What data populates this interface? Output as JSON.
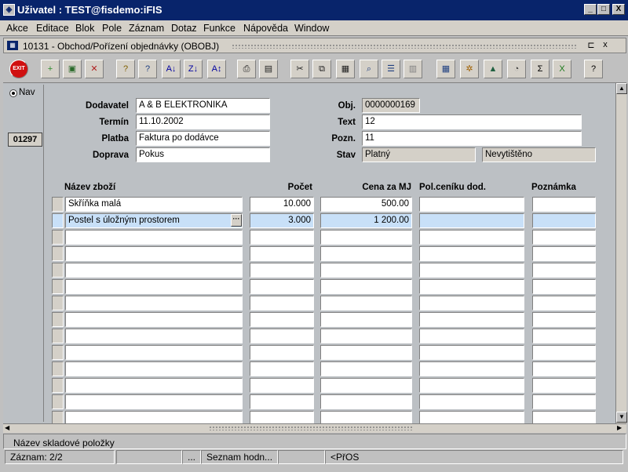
{
  "window": {
    "title": "Uživatel : TEST@fisdemo:iFIS",
    "minimize": "_",
    "maximize": "□",
    "close": "X"
  },
  "menu": [
    "Akce",
    "Editace",
    "Blok",
    "Pole",
    "Záznam",
    "Dotaz",
    "Funkce",
    "Nápověda",
    "Window"
  ],
  "subwindow": {
    "title": "10131 - Obchod/Pořízení objednávky (OBOBJ)"
  },
  "toolbar": [
    {
      "name": "exit-icon",
      "glyph": "EXIT",
      "color": "#d01010"
    },
    {
      "name": "insert-record-icon",
      "glyph": "+",
      "color": "#2a8a2a"
    },
    {
      "name": "save-icon",
      "glyph": "▣",
      "color": "#2a6a2a"
    },
    {
      "name": "delete-record-icon",
      "glyph": "✕",
      "color": "#b02020"
    },
    {
      "name": "query-icon",
      "glyph": "?",
      "color": "#806000"
    },
    {
      "name": "execute-query-icon",
      "glyph": "?",
      "color": "#204080"
    },
    {
      "name": "sort-asc-icon",
      "glyph": "A↓",
      "color": "#0000a0"
    },
    {
      "name": "sort-desc-icon",
      "glyph": "Z↓",
      "color": "#0000a0"
    },
    {
      "name": "sort-multi-icon",
      "glyph": "A↕",
      "color": "#0000a0"
    },
    {
      "name": "print-icon",
      "glyph": "⎙",
      "color": "#202020"
    },
    {
      "name": "print-preview-icon",
      "glyph": "▤",
      "color": "#202020"
    },
    {
      "name": "cut-icon",
      "glyph": "✂",
      "color": "#202020"
    },
    {
      "name": "copy-icon",
      "glyph": "⧉",
      "color": "#202020"
    },
    {
      "name": "paste-icon",
      "glyph": "▦",
      "color": "#202020"
    },
    {
      "name": "find-icon",
      "glyph": "⌕",
      "color": "#204080"
    },
    {
      "name": "list-icon",
      "glyph": "☰",
      "color": "#204080"
    },
    {
      "name": "columns-icon",
      "glyph": "▥",
      "color": "#808080"
    },
    {
      "name": "calculator-icon",
      "glyph": "▦",
      "color": "#204080"
    },
    {
      "name": "tools-icon",
      "glyph": "✲",
      "color": "#a06000"
    },
    {
      "name": "triangle-icon",
      "glyph": "▲",
      "color": "#206040"
    },
    {
      "name": "clock-icon",
      "glyph": "◔",
      "color": "#404040"
    },
    {
      "name": "sum-icon",
      "glyph": "Σ",
      "color": "#000000"
    },
    {
      "name": "excel-icon",
      "glyph": "X",
      "color": "#1a7a1a"
    },
    {
      "name": "help-icon",
      "glyph": "?",
      "color": "#000000"
    }
  ],
  "nav": {
    "label": "Nav",
    "record": "01297"
  },
  "header": {
    "dodavatel": {
      "label": "Dodavatel",
      "value": "A & B ELEKTRONIKA"
    },
    "termin": {
      "label": "Termín",
      "value": "11.10.2002"
    },
    "platba": {
      "label": "Platba",
      "value": "Faktura po dodávce"
    },
    "doprava": {
      "label": "Doprava",
      "value": "Pokus"
    },
    "obj": {
      "label": "Obj.",
      "value": "0000000169"
    },
    "text": {
      "label": "Text",
      "value": "12"
    },
    "pozn": {
      "label": "Pozn.",
      "value": "11"
    },
    "stav": {
      "label": "Stav",
      "value": "Platný",
      "value2": "Nevytištěno"
    }
  },
  "items": {
    "columns": [
      "Název zboží",
      "Počet",
      "Cena za MJ",
      "Pol.ceníku dod.",
      "Poznámka"
    ],
    "rows": [
      {
        "name": "Skříňka malá",
        "qty": "10.000",
        "price": "500.00",
        "pol": "",
        "note": ""
      },
      {
        "name": "Postel s úložným prostorem",
        "qty": "3.000",
        "price": "1 200.00",
        "pol": "",
        "note": ""
      },
      {
        "name": "",
        "qty": "",
        "price": "",
        "pol": "",
        "note": ""
      },
      {
        "name": "",
        "qty": "",
        "price": "",
        "pol": "",
        "note": ""
      },
      {
        "name": "",
        "qty": "",
        "price": "",
        "pol": "",
        "note": ""
      },
      {
        "name": "",
        "qty": "",
        "price": "",
        "pol": "",
        "note": ""
      },
      {
        "name": "",
        "qty": "",
        "price": "",
        "pol": "",
        "note": ""
      },
      {
        "name": "",
        "qty": "",
        "price": "",
        "pol": "",
        "note": ""
      },
      {
        "name": "",
        "qty": "",
        "price": "",
        "pol": "",
        "note": ""
      },
      {
        "name": "",
        "qty": "",
        "price": "",
        "pol": "",
        "note": ""
      },
      {
        "name": "",
        "qty": "",
        "price": "",
        "pol": "",
        "note": ""
      },
      {
        "name": "",
        "qty": "",
        "price": "",
        "pol": "",
        "note": ""
      },
      {
        "name": "",
        "qty": "",
        "price": "",
        "pol": "",
        "note": ""
      },
      {
        "name": "",
        "qty": "",
        "price": "",
        "pol": "",
        "note": ""
      }
    ]
  },
  "hint": "Název skladové položky",
  "statusbar": {
    "record": "Záznam: 2/2",
    "s2": "",
    "s3": "...",
    "s4": "Seznam hodn...",
    "s5": "",
    "s6": "<PřOS"
  }
}
